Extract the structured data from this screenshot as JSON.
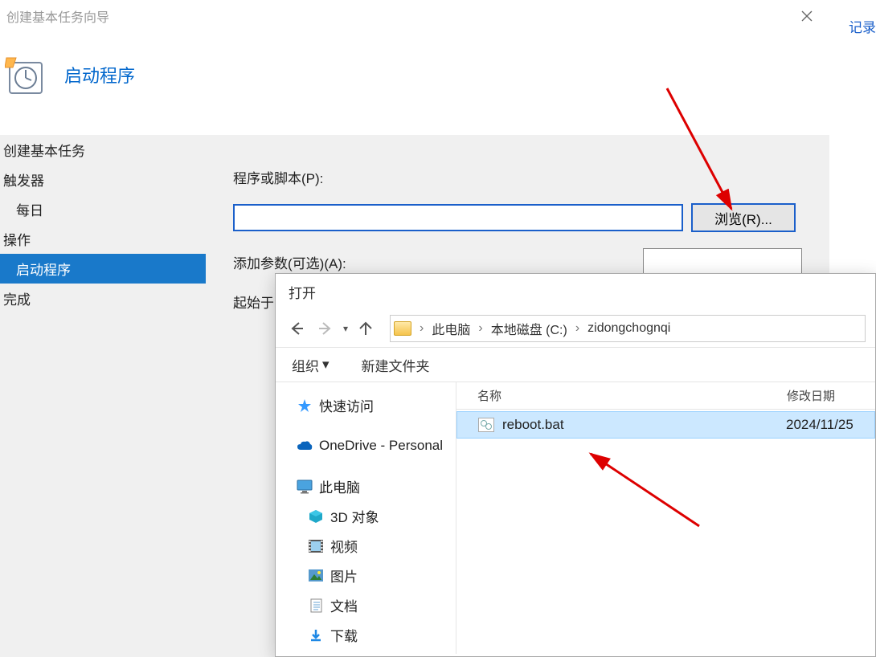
{
  "wizard": {
    "title": "创建基本任务向导",
    "heading": "启动程序",
    "sidebar": {
      "create": "创建基本任务",
      "trigger": "触发器",
      "daily": "每日",
      "action": "操作",
      "start_prog": "启动程序",
      "finish": "完成"
    },
    "form": {
      "program_label": "程序或脚本(P):",
      "program_value": "",
      "browse": "浏览(R)...",
      "args_label": "添加参数(可选)(A):",
      "args_value": "",
      "startin_label": "起始于"
    }
  },
  "file_dialog": {
    "title": "打开",
    "breadcrumb": {
      "pc": "此电脑",
      "drive": "本地磁盘 (C:)",
      "folder": "zidongchognqi"
    },
    "toolbar": {
      "organize": "组织",
      "new_folder": "新建文件夹"
    },
    "tree": {
      "quick": "快速访问",
      "onedrive": "OneDrive - Personal",
      "pc": "此电脑",
      "objects3d": "3D 对象",
      "videos": "视频",
      "pictures": "图片",
      "documents": "文档",
      "downloads": "下载"
    },
    "list": {
      "col_name": "名称",
      "col_date": "修改日期",
      "file": "reboot.bat",
      "date": "2024/11/25"
    }
  },
  "bg": {
    "label": "记录"
  }
}
